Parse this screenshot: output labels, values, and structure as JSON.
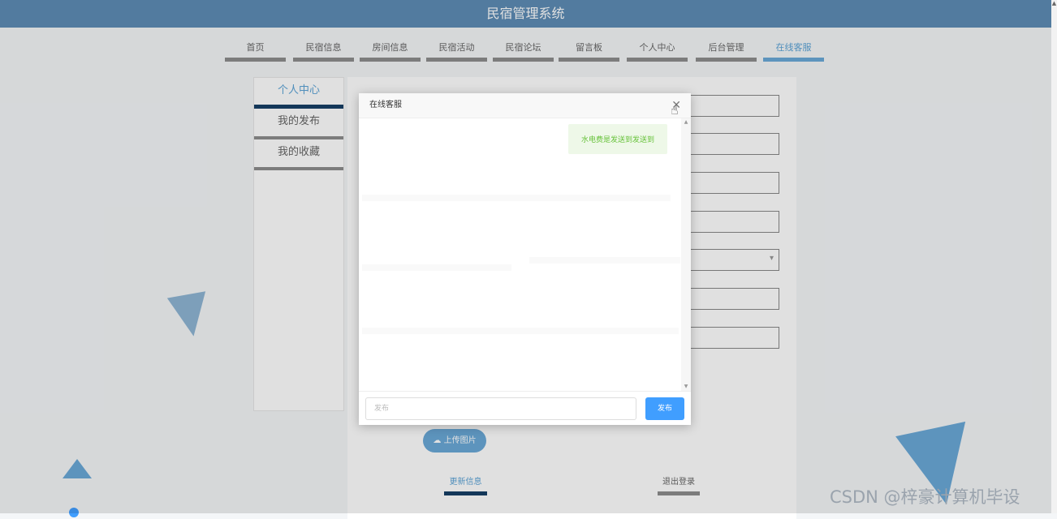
{
  "header": {
    "title": "民宿管理系统"
  },
  "nav": {
    "items": [
      {
        "label": "首页",
        "active": false
      },
      {
        "label": "民宿信息",
        "active": false
      },
      {
        "label": "房间信息",
        "active": false
      },
      {
        "label": "民宿活动",
        "active": false
      },
      {
        "label": "民宿论坛",
        "active": false
      },
      {
        "label": "留言板",
        "active": false
      },
      {
        "label": "个人中心",
        "active": false
      },
      {
        "label": "后台管理",
        "active": false
      },
      {
        "label": "在线客服",
        "active": true
      }
    ]
  },
  "sidebar": {
    "items": [
      {
        "label": "个人中心",
        "active": true
      },
      {
        "label": "我的发布",
        "active": false
      },
      {
        "label": "我的收藏",
        "active": false
      }
    ]
  },
  "form": {
    "upload_label": "上传图片",
    "update_label": "更新信息",
    "logout_label": "退出登录"
  },
  "dialog": {
    "title": "在线客服",
    "close_icon": "close-icon",
    "messages": [
      {
        "side": "right",
        "text": "水电费是发送到发送到"
      }
    ],
    "input_placeholder": "发布",
    "send_label": "发布"
  },
  "colors": {
    "header_bg": "#5e8db5",
    "accent": "#6aa9d8",
    "send_button": "#409eff",
    "bubble_text": "#67c23a"
  },
  "watermark": "CSDN @梓豪计算机毕设"
}
